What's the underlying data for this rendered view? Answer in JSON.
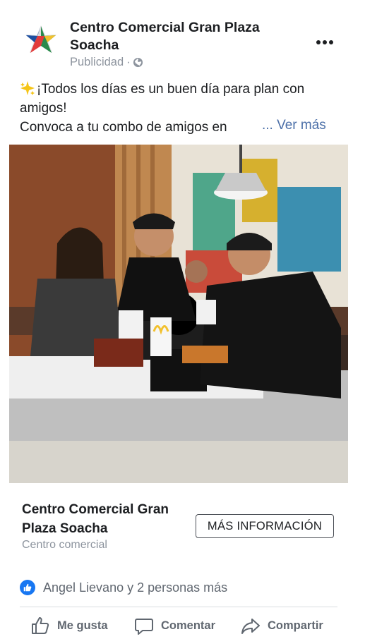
{
  "post": {
    "page_name": "Centro Comercial Gran Plaza Soacha",
    "sponsored_label": "Publicidad",
    "separator": "·",
    "caption_line1": "¡Todos los días es un buen día para plan con",
    "caption_line2": "amigos!",
    "caption_line3": "Convoca a tu combo de amigos en",
    "see_more": "... Ver más"
  },
  "cta": {
    "title": "Centro Comercial Gran Plaza Soacha",
    "subtitle": "Centro comercial",
    "button_label": "MÁS INFORMACIÓN"
  },
  "reactions": {
    "summary": "Angel Lievano y 2 personas más"
  },
  "actions": {
    "like": "Me gusta",
    "comment": "Comentar",
    "share": "Compartir"
  },
  "colors": {
    "link": "#4b6fa8",
    "like_blue": "#1877f2",
    "muted": "#8d949e"
  }
}
